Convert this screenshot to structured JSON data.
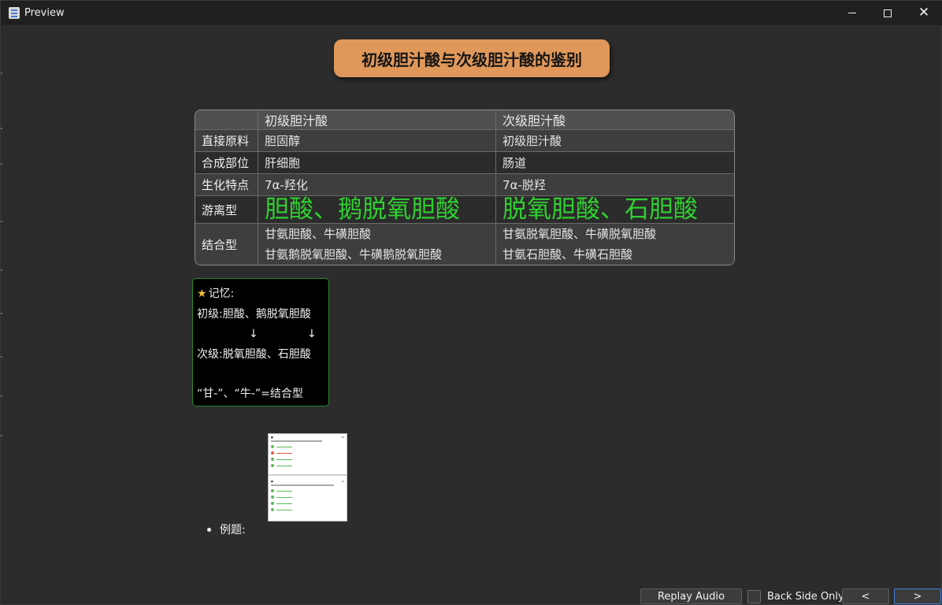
{
  "window": {
    "title": "Preview"
  },
  "card": {
    "title": "初级胆汁酸与次级胆汁酸的鉴别",
    "table": {
      "headers": [
        "",
        "初级胆汁酸",
        "次级胆汁酸"
      ],
      "rows": [
        {
          "label": "直接原料",
          "primary": "胆固醇",
          "secondary": "初级胆汁酸"
        },
        {
          "label": "合成部位",
          "primary": "肝细胞",
          "secondary": "肠道"
        },
        {
          "label": "生化特点",
          "primary": "7α-羟化",
          "secondary": "7α-脱羟"
        },
        {
          "label": "游离型",
          "primary": "胆酸、鹅脱氧胆酸",
          "secondary": "脱氧胆酸、石胆酸"
        },
        {
          "label": "结合型",
          "primary_lines": [
            "甘氨胆酸、牛磺胆酸",
            "甘氨鹅脱氧胆酸、牛磺鹅脱氧胆酸"
          ],
          "secondary_lines": [
            "甘氨脱氧胆酸、牛磺脱氧胆酸",
            "甘氨石胆酸、牛磺石胆酸"
          ]
        }
      ]
    },
    "memo": {
      "star": "★",
      "heading": "记忆:",
      "line_primary": "初级:胆酸、鹅脱氧胆酸",
      "arrow": "↓",
      "line_secondary": "次级:脱氧胆酸、石胆酸",
      "line_conjugate": "“甘-”、“牛-”=结合型"
    },
    "example_label": "例题:",
    "example_image": {
      "top_number": "12",
      "bottom_number": "13"
    }
  },
  "toolbar": {
    "replay_label": "Replay Audio",
    "back_side_only_label": "Back Side Only",
    "back_side_only_checked": false,
    "prev_label": "<",
    "next_label": ">"
  },
  "colors": {
    "background": "#2c2c2c",
    "title_badge": "#e0985a",
    "free_form_highlight": "#2fd02f",
    "memo_border": "#2a8a2a",
    "star": "#f2c033",
    "next_focus": "#3f7fd6"
  }
}
